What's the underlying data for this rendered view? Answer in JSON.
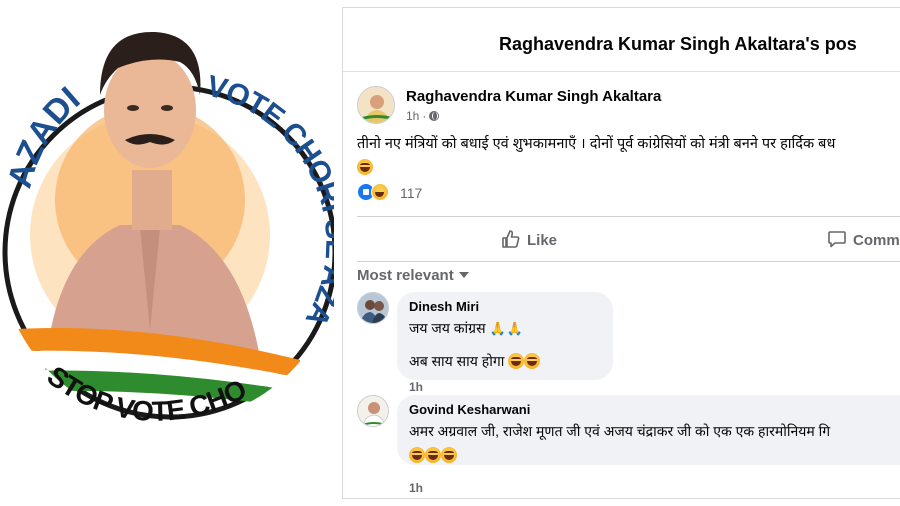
{
  "badge": {
    "arc_left_text": "AZADI",
    "arc_right_text": "VOTE CHORI SE AZADI",
    "bottom_text": "STOP VOTE CHORI",
    "colors": {
      "ring": "#1a1a1a",
      "saffron": "#f28a1a",
      "green": "#2e8b2e",
      "text_orange": "#e06a1a",
      "text_blue": "#1c4f8f"
    }
  },
  "post": {
    "header_title": "Raghavendra Kumar Singh Akaltara's pos",
    "author": "Raghavendra Kumar Singh Akaltara",
    "time": "1h",
    "visibility_icon": "globe-icon",
    "text": "तीनो नए मंत्रियों को बधाई एवं शुभकामनाएँ । दोनों पूर्व कांग्रेसियों को मंत्री बनने पर हार्दिक बध",
    "reaction_count": "117",
    "like_label": "Like",
    "comment_label": "Comm",
    "sort_label": "Most relevant"
  },
  "comments": [
    {
      "name": "Dinesh Miri",
      "line1": "जय जय कांग्रस",
      "line1_emoji": "🙏🙏",
      "line2": "अब साय साय होगा",
      "time": "1h"
    },
    {
      "name": "Govind Kesharwani",
      "line1": "अमर अग्रवाल जी, राजेश मूणत जी एवं अजय चंद्राकर जी को एक एक हारमोनियम गि",
      "time": "1h"
    }
  ]
}
